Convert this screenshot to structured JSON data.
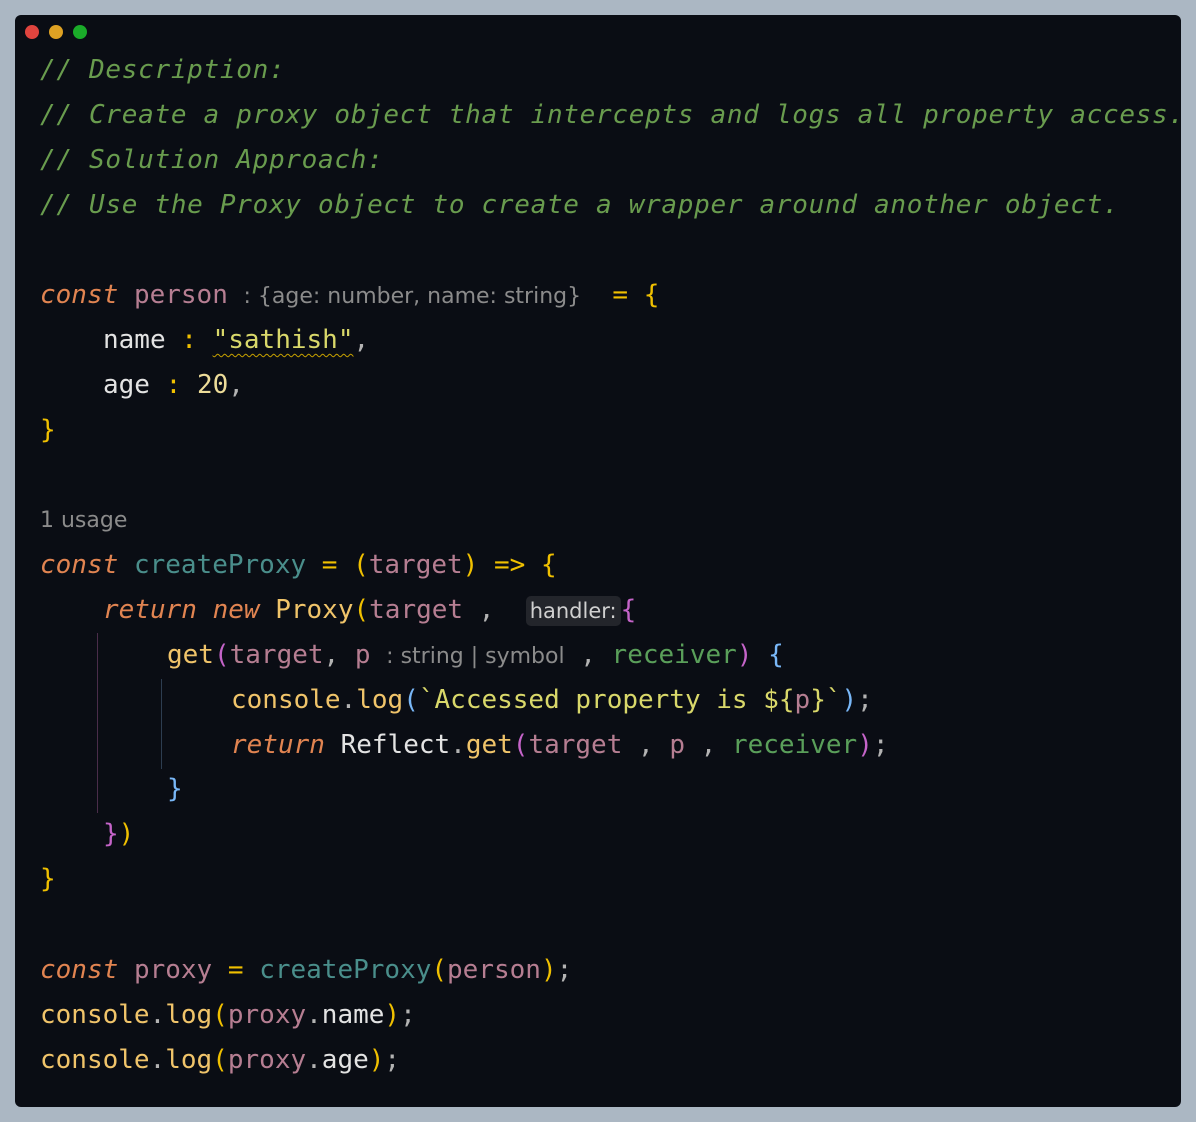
{
  "window": {
    "controls": [
      "close-dot",
      "minimize-dot",
      "maximize-dot"
    ],
    "colors": {
      "background": "#0a0d14",
      "page": "#abb7c3",
      "close": "#e0443e",
      "minimize": "#dea123",
      "maximize": "#1aab29"
    }
  },
  "code": {
    "comments": [
      "// Description:",
      "// Create a proxy object that intercepts and logs all property access.",
      "// Solution Approach:",
      "// Use the Proxy object to create a wrapper around another object."
    ],
    "kw_const": "const",
    "kw_return": "return",
    "kw_new": "new",
    "person_var": "person",
    "person_type_hint": ": {age: number, name: string}",
    "assign_open": "= {",
    "prop_name": "name",
    "prop_sep": ":",
    "prop_name_value": "\"sathish\"",
    "comma": ",",
    "prop_age": "age",
    "prop_age_value": "20",
    "close_brace": "}",
    "usage_hint": "1 usage",
    "create_proxy_fn": "createProxy",
    "equals": "=",
    "target_param": "target",
    "arrow": "=>",
    "proxy_class": "Proxy",
    "handler_hint": "handler:",
    "get_method": "get",
    "p_param": "p",
    "p_type_hint": ": string | symbol",
    "receiver_param": "receiver",
    "console_obj": "console",
    "log_method": "log",
    "template_text": "`Accessed property is ${",
    "template_end": "}`",
    "reflect_obj": "Reflect",
    "proxy_var": "proxy",
    "name_access": "name",
    "age_access": "age"
  }
}
